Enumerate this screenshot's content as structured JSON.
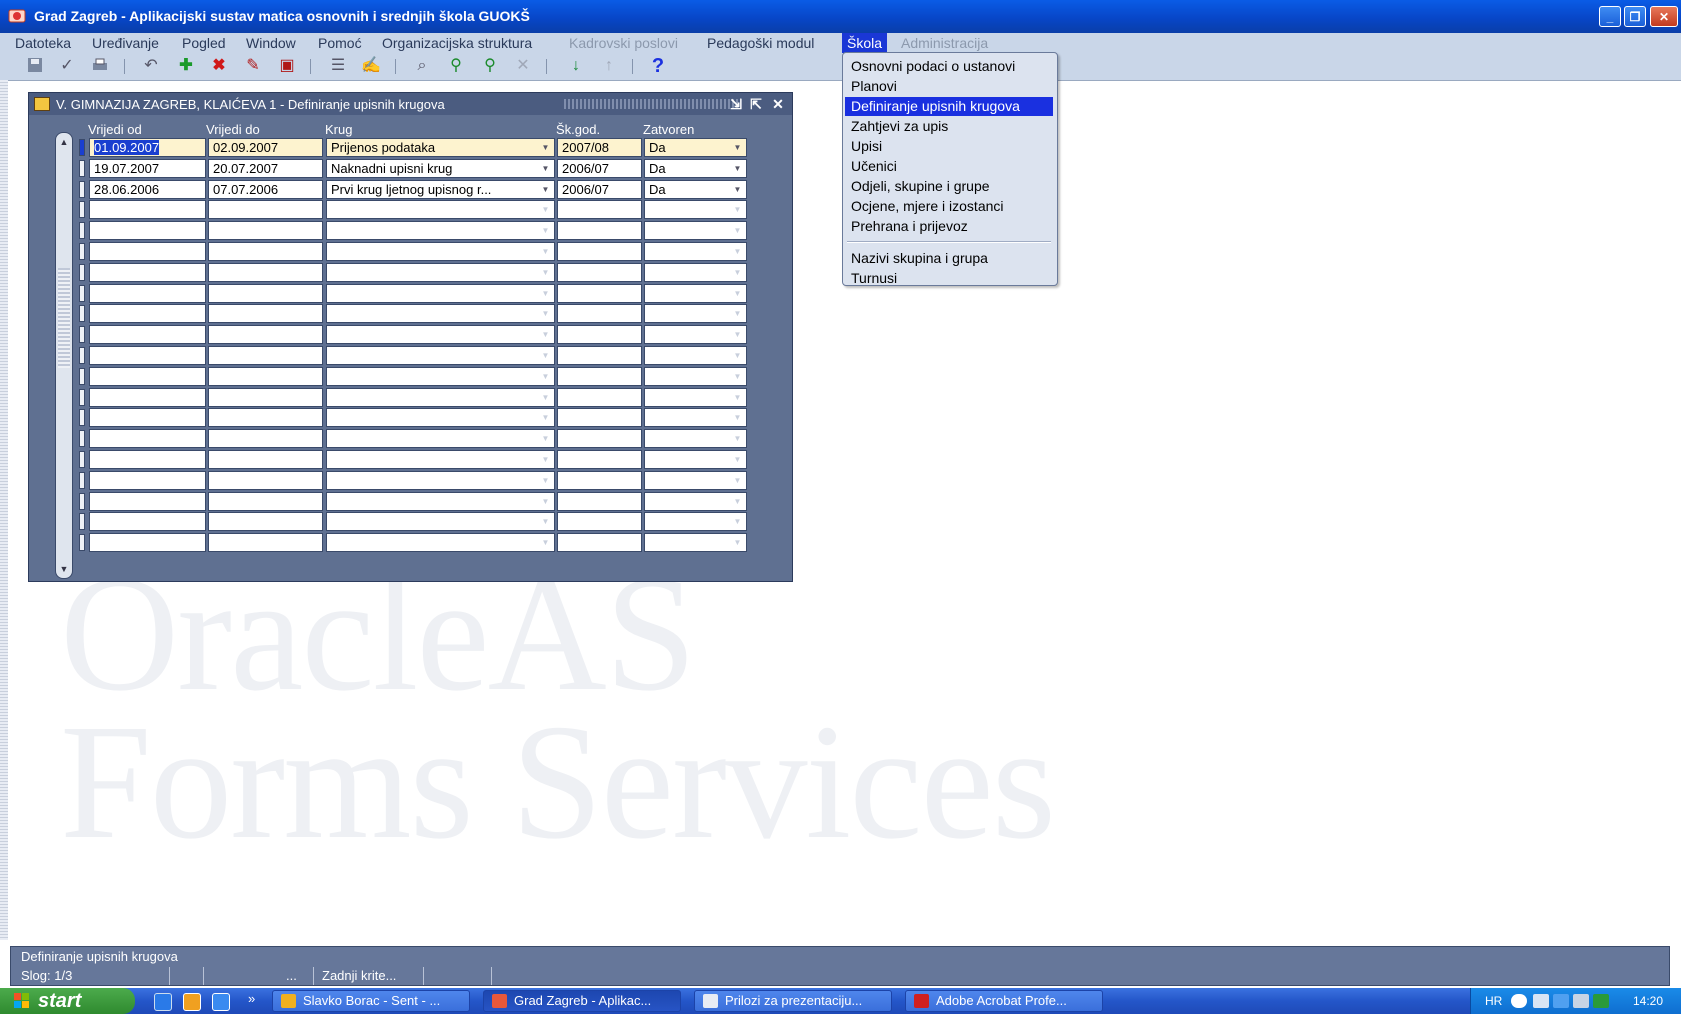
{
  "window": {
    "title": "Grad Zagreb - Aplikacijski sustav matica osnovnih i srednjih škola GUOKŠ",
    "minimize": "_",
    "restore": "❐",
    "close": "✕"
  },
  "menubar": [
    {
      "label": "Datoteka",
      "state": "normal"
    },
    {
      "label": "Uređivanje",
      "state": "normal"
    },
    {
      "label": "Pogled",
      "state": "normal"
    },
    {
      "label": "Window",
      "state": "normal"
    },
    {
      "label": "Pomoć",
      "state": "normal"
    },
    {
      "label": "Organizacijska struktura",
      "state": "normal"
    },
    {
      "label": "Kadrovski poslovi",
      "state": "disabled"
    },
    {
      "label": "Pedagoški modul",
      "state": "normal"
    },
    {
      "label": "Škola",
      "state": "active"
    },
    {
      "label": "Administracija",
      "state": "disabled"
    }
  ],
  "toolbar_icons": [
    "save-icon",
    "accept-icon",
    "print-icon",
    "undo-icon",
    "insert-record-icon",
    "delete-record-icon",
    "clear-record-icon",
    "lock-record-icon",
    "block-icon",
    "edit-icon",
    "query-icon",
    "execute-query-icon",
    "count-query-icon",
    "cancel-query-icon",
    "next-record-icon",
    "previous-record-icon",
    "help-icon"
  ],
  "form": {
    "title": "V. GIMNAZIJA ZAGREB, KLAIĆEVA 1 - Definiranje upisnih krugova",
    "columns": {
      "vrijedi_od": "Vrijedi od",
      "vrijedi_do": "Vrijedi do",
      "krug": "Krug",
      "sk_god": "Šk.god.",
      "zatvoren": "Zatvoren"
    },
    "rows": [
      {
        "vrijedi_od": "01.09.2007",
        "vrijedi_do": "02.09.2007",
        "krug": "Prijenos podataka",
        "sk_god": "2007/08",
        "zatvoren": "Da"
      },
      {
        "vrijedi_od": "19.07.2007",
        "vrijedi_do": "20.07.2007",
        "krug": "Naknadni upisni krug",
        "sk_god": "2006/07",
        "zatvoren": "Da"
      },
      {
        "vrijedi_od": "28.06.2006",
        "vrijedi_do": "07.07.2006",
        "krug": "Prvi krug ljetnog upisnog r...",
        "sk_god": "2006/07",
        "zatvoren": "Da"
      }
    ],
    "empty_rows": 17,
    "lov_button": "···"
  },
  "dropdown_menu": {
    "items": [
      {
        "label": "Osnovni podaci o ustanovi",
        "highlighted": false
      },
      {
        "label": "Planovi",
        "highlighted": false
      },
      {
        "label": "Definiranje upisnih krugova",
        "highlighted": true
      },
      {
        "label": "Zahtjevi za upis",
        "highlighted": false
      },
      {
        "label": "Upisi",
        "highlighted": false
      },
      {
        "label": "Učenici",
        "highlighted": false
      },
      {
        "label": "Odjeli, skupine i grupe",
        "highlighted": false
      },
      {
        "label": "Ocjene, mjere i izostanci",
        "highlighted": false
      },
      {
        "label": "Prehrana i prijevoz",
        "highlighted": false
      },
      {
        "label": "Nazivi skupina i grupa",
        "highlighted": false
      },
      {
        "label": "Turnusi",
        "highlighted": false
      }
    ]
  },
  "watermark": {
    "line1": "OracleAS",
    "line2": "Forms Services"
  },
  "statusbar": {
    "message": "Definiranje upisnih krugova",
    "record": "Slog: 1/3",
    "ellipsis": "...",
    "criteria": "Zadnji krite..."
  },
  "taskbar": {
    "start": "start",
    "overflow": "»",
    "tasks": [
      {
        "label": "Slavko Borac - Sent - ...",
        "icon": "email-icon",
        "active": false
      },
      {
        "label": "Grad Zagreb - Aplikac...",
        "icon": "oracle-forms-icon",
        "active": true
      },
      {
        "label": "Prilozi za prezentaciju...",
        "icon": "document-icon",
        "active": false
      },
      {
        "label": "Adobe Acrobat Profe...",
        "icon": "acrobat-icon",
        "active": false
      }
    ],
    "language": "HR",
    "clock": "14:20"
  },
  "colors": {
    "titlebar": "#0746c8",
    "form_bg": "#5f7091",
    "menu_highlight": "#1a30e0",
    "required_field": "#fdf3cf",
    "statusbar": "#66779a"
  }
}
